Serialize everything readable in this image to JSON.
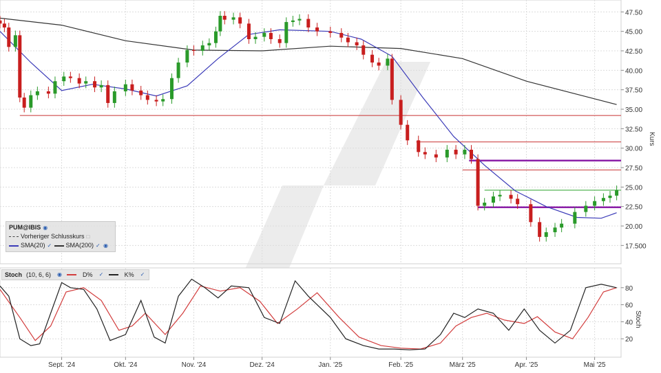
{
  "chart_data": [
    {
      "type": "candlestick",
      "symbol": "PUM@IBIS",
      "ylabel": "Kurs",
      "ylim": [
        15.5,
        48.5
      ],
      "yticks": [
        "17.500",
        "20.00",
        "22.50",
        "25.00",
        "27.50",
        "30.00",
        "32.50",
        "35.00",
        "37.50",
        "40.00",
        "42.50",
        "45.00",
        "47.50"
      ],
      "ytick_values": [
        17.5,
        20.0,
        22.5,
        25.0,
        27.5,
        30.0,
        32.5,
        35.0,
        37.5,
        40.0,
        42.5,
        45.0,
        47.5
      ],
      "x_range": [
        "2024-08-05",
        "2025-05-14"
      ],
      "xticks": [
        {
          "date": "2024-09-02",
          "label": "Sept. '24"
        },
        {
          "date": "2024-10-01",
          "label": "Okt. '24"
        },
        {
          "date": "2024-11-01",
          "label": "Nov. '24"
        },
        {
          "date": "2024-12-02",
          "label": "Dez. '24"
        },
        {
          "date": "2025-01-02",
          "label": "Jan. '25"
        },
        {
          "date": "2025-02-03",
          "label": "Feb. '25"
        },
        {
          "date": "2025-03-03",
          "label": "März '25"
        },
        {
          "date": "2025-04-01",
          "label": "Apr. '25"
        },
        {
          "date": "2025-05-02",
          "label": "Mai '25"
        }
      ],
      "close_series": [
        [
          "2024-08-05",
          46.0
        ],
        [
          "2024-08-07",
          45.5
        ],
        [
          "2024-08-09",
          43.0
        ],
        [
          "2024-08-12",
          44.5
        ],
        [
          "2024-08-14",
          36.5
        ],
        [
          "2024-08-16",
          35.2
        ],
        [
          "2024-08-19",
          36.8
        ],
        [
          "2024-08-22",
          37.3
        ],
        [
          "2024-08-27",
          37.0
        ],
        [
          "2024-08-30",
          38.6
        ],
        [
          "2024-09-03",
          39.2
        ],
        [
          "2024-09-06",
          39.0
        ],
        [
          "2024-09-10",
          38.3
        ],
        [
          "2024-09-13",
          38.6
        ],
        [
          "2024-09-17",
          37.8
        ],
        [
          "2024-09-20",
          38.1
        ],
        [
          "2024-09-23",
          35.8
        ],
        [
          "2024-09-26",
          37.3
        ],
        [
          "2024-10-01",
          38.2
        ],
        [
          "2024-10-04",
          37.4
        ],
        [
          "2024-10-08",
          36.8
        ],
        [
          "2024-10-11",
          36.2
        ],
        [
          "2024-10-15",
          36.0
        ],
        [
          "2024-10-18",
          36.3
        ],
        [
          "2024-10-22",
          39.0
        ],
        [
          "2024-10-25",
          41.0
        ],
        [
          "2024-10-29",
          42.6
        ],
        [
          "2024-11-01",
          42.5
        ],
        [
          "2024-11-05",
          43.2
        ],
        [
          "2024-11-08",
          43.5
        ],
        [
          "2024-11-11",
          45.0
        ],
        [
          "2024-11-13",
          47.0
        ],
        [
          "2024-11-15",
          46.5
        ],
        [
          "2024-11-19",
          46.8
        ],
        [
          "2024-11-22",
          46.0
        ],
        [
          "2024-11-26",
          44.0
        ],
        [
          "2024-11-29",
          44.3
        ],
        [
          "2024-12-03",
          44.8
        ],
        [
          "2024-12-06",
          44.0
        ],
        [
          "2024-12-10",
          43.5
        ],
        [
          "2024-12-13",
          46.2
        ],
        [
          "2024-12-16",
          46.4
        ],
        [
          "2024-12-19",
          46.6
        ],
        [
          "2024-12-23",
          45.5
        ],
        [
          "2024-12-27",
          45.0
        ],
        [
          "2025-01-02",
          44.8
        ],
        [
          "2025-01-07",
          44.2
        ],
        [
          "2025-01-10",
          43.6
        ],
        [
          "2025-01-14",
          43.2
        ],
        [
          "2025-01-17",
          42.0
        ],
        [
          "2025-01-21",
          41.0
        ],
        [
          "2025-01-24",
          40.6
        ],
        [
          "2025-01-28",
          41.5
        ],
        [
          "2025-01-30",
          36.2
        ],
        [
          "2025-02-03",
          33.0
        ],
        [
          "2025-02-06",
          31.0
        ],
        [
          "2025-02-11",
          29.5
        ],
        [
          "2025-02-14",
          29.2
        ],
        [
          "2025-02-19",
          28.8
        ],
        [
          "2025-02-24",
          29.8
        ],
        [
          "2025-02-28",
          29.2
        ],
        [
          "2025-03-04",
          29.8
        ],
        [
          "2025-03-07",
          28.6
        ],
        [
          "2025-03-10",
          22.6
        ],
        [
          "2025-03-13",
          23.0
        ],
        [
          "2025-03-17",
          23.8
        ],
        [
          "2025-03-20",
          24.0
        ],
        [
          "2025-03-25",
          23.5
        ],
        [
          "2025-03-28",
          22.8
        ],
        [
          "2025-04-03",
          20.5
        ],
        [
          "2025-04-07",
          18.6
        ],
        [
          "2025-04-10",
          19.2
        ],
        [
          "2025-04-14",
          19.8
        ],
        [
          "2025-04-17",
          20.3
        ],
        [
          "2025-04-23",
          21.8
        ],
        [
          "2025-04-28",
          22.6
        ],
        [
          "2025-05-02",
          23.2
        ],
        [
          "2025-05-06",
          23.6
        ],
        [
          "2025-05-09",
          23.9
        ],
        [
          "2025-05-12",
          24.6
        ]
      ],
      "sma20": [
        [
          "2024-08-05",
          45.0
        ],
        [
          "2024-08-19",
          41.0
        ],
        [
          "2024-09-02",
          37.4
        ],
        [
          "2024-09-16",
          38.2
        ],
        [
          "2024-10-01",
          37.6
        ],
        [
          "2024-10-15",
          36.7
        ],
        [
          "2024-10-29",
          38.0
        ],
        [
          "2024-11-12",
          41.5
        ],
        [
          "2024-11-26",
          44.6
        ],
        [
          "2024-12-10",
          45.2
        ],
        [
          "2025-01-02",
          45.0
        ],
        [
          "2025-01-16",
          44.0
        ],
        [
          "2025-01-30",
          41.8
        ],
        [
          "2025-02-13",
          36.5
        ],
        [
          "2025-02-27",
          31.5
        ],
        [
          "2025-03-13",
          27.8
        ],
        [
          "2025-03-27",
          24.5
        ],
        [
          "2025-04-10",
          22.5
        ],
        [
          "2025-04-24",
          21.1
        ],
        [
          "2025-05-05",
          21.0
        ],
        [
          "2025-05-12",
          21.7
        ]
      ],
      "sma200": [
        [
          "2024-08-05",
          46.7
        ],
        [
          "2024-09-02",
          45.8
        ],
        [
          "2024-10-01",
          43.8
        ],
        [
          "2024-11-01",
          42.6
        ],
        [
          "2024-12-02",
          42.5
        ],
        [
          "2025-01-02",
          43.1
        ],
        [
          "2025-02-03",
          42.8
        ],
        [
          "2025-03-03",
          41.5
        ],
        [
          "2025-04-01",
          38.6
        ],
        [
          "2025-05-01",
          36.4
        ],
        [
          "2025-05-12",
          35.6
        ]
      ],
      "horizontal_lines": [
        {
          "y": 34.2,
          "color": "#c83232",
          "from": "2024-08-14",
          "to": "2025-05-14"
        },
        {
          "y": 30.8,
          "color": "#c83232",
          "from": "2025-02-10",
          "to": "2025-05-14"
        },
        {
          "y": 28.4,
          "color": "#8b1fa8",
          "from": "2025-03-06",
          "to": "2025-05-14"
        },
        {
          "y": 27.2,
          "color": "#c83232",
          "from": "2025-03-03",
          "to": "2025-05-14"
        },
        {
          "y": 24.6,
          "color": "#2aa02a",
          "from": "2025-03-13",
          "to": "2025-05-14"
        },
        {
          "y": 22.4,
          "color": "#8b1fa8",
          "from": "2025-03-10",
          "to": "2025-05-14"
        }
      ],
      "legend": [
        "PUM@IBIS",
        "Vorheriger Schlusskurs",
        "SMA(20)",
        "SMA(200)"
      ],
      "colors": {
        "up": "#2a9a2a",
        "down": "#c81e1e",
        "sma20": "#3a3ab8",
        "sma200": "#333333"
      }
    },
    {
      "type": "line",
      "title": "Stoch",
      "params": "(10, 6, 6)",
      "ylabel": "Stoch",
      "ylim": [
        0,
        100
      ],
      "yticks": [
        "20",
        "40",
        "60",
        "80"
      ],
      "ytick_values": [
        20,
        40,
        60,
        80
      ],
      "series": [
        {
          "name": "K%",
          "color": "#222222",
          "points": [
            [
              "2024-08-05",
              82
            ],
            [
              "2024-08-09",
              70
            ],
            [
              "2024-08-14",
              20
            ],
            [
              "2024-08-19",
              12
            ],
            [
              "2024-08-23",
              14
            ],
            [
              "2024-08-28",
              50
            ],
            [
              "2024-09-02",
              86
            ],
            [
              "2024-09-06",
              80
            ],
            [
              "2024-09-12",
              78
            ],
            [
              "2024-09-18",
              55
            ],
            [
              "2024-09-24",
              18
            ],
            [
              "2024-10-01",
              25
            ],
            [
              "2024-10-08",
              65
            ],
            [
              "2024-10-14",
              22
            ],
            [
              "2024-10-19",
              15
            ],
            [
              "2024-10-25",
              70
            ],
            [
              "2024-10-31",
              90
            ],
            [
              "2024-11-06",
              80
            ],
            [
              "2024-11-12",
              68
            ],
            [
              "2024-11-18",
              82
            ],
            [
              "2024-11-26",
              80
            ],
            [
              "2024-12-03",
              45
            ],
            [
              "2024-12-10",
              38
            ],
            [
              "2024-12-17",
              88
            ],
            [
              "2024-12-23",
              70
            ],
            [
              "2025-01-02",
              45
            ],
            [
              "2025-01-09",
              20
            ],
            [
              "2025-01-17",
              12
            ],
            [
              "2025-01-24",
              8
            ],
            [
              "2025-01-31",
              8
            ],
            [
              "2025-02-07",
              7
            ],
            [
              "2025-02-14",
              8
            ],
            [
              "2025-02-21",
              25
            ],
            [
              "2025-02-27",
              50
            ],
            [
              "2025-03-04",
              45
            ],
            [
              "2025-03-10",
              55
            ],
            [
              "2025-03-17",
              50
            ],
            [
              "2025-03-24",
              30
            ],
            [
              "2025-03-31",
              55
            ],
            [
              "2025-04-07",
              30
            ],
            [
              "2025-04-14",
              15
            ],
            [
              "2025-04-21",
              30
            ],
            [
              "2025-04-28",
              80
            ],
            [
              "2025-05-05",
              84
            ],
            [
              "2025-05-12",
              80
            ]
          ]
        },
        {
          "name": "D%",
          "color": "#d23c3c",
          "points": [
            [
              "2024-08-05",
              78
            ],
            [
              "2024-08-14",
              45
            ],
            [
              "2024-08-21",
              18
            ],
            [
              "2024-08-28",
              35
            ],
            [
              "2024-09-04",
              75
            ],
            [
              "2024-09-12",
              80
            ],
            [
              "2024-09-20",
              65
            ],
            [
              "2024-09-28",
              30
            ],
            [
              "2024-10-04",
              35
            ],
            [
              "2024-10-10",
              50
            ],
            [
              "2024-10-19",
              25
            ],
            [
              "2024-10-27",
              50
            ],
            [
              "2024-11-04",
              82
            ],
            [
              "2024-11-13",
              76
            ],
            [
              "2024-11-22",
              80
            ],
            [
              "2024-12-01",
              64
            ],
            [
              "2024-12-09",
              38
            ],
            [
              "2024-12-18",
              55
            ],
            [
              "2024-12-27",
              74
            ],
            [
              "2025-01-06",
              45
            ],
            [
              "2025-01-15",
              22
            ],
            [
              "2025-01-25",
              12
            ],
            [
              "2025-02-03",
              9
            ],
            [
              "2025-02-12",
              8
            ],
            [
              "2025-02-21",
              15
            ],
            [
              "2025-02-28",
              35
            ],
            [
              "2025-03-07",
              45
            ],
            [
              "2025-03-14",
              50
            ],
            [
              "2025-03-22",
              42
            ],
            [
              "2025-03-31",
              38
            ],
            [
              "2025-04-06",
              46
            ],
            [
              "2025-04-14",
              28
            ],
            [
              "2025-04-22",
              20
            ],
            [
              "2025-04-29",
              45
            ],
            [
              "2025-05-06",
              75
            ],
            [
              "2025-05-12",
              80
            ]
          ]
        }
      ]
    }
  ]
}
